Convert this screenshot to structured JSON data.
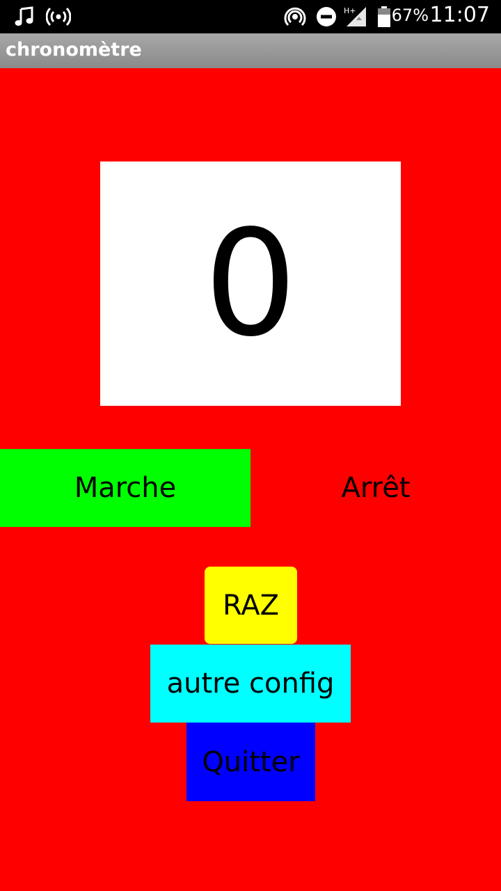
{
  "status_bar": {
    "icons": [
      "music-note-icon",
      "hotspot-icon",
      "nfc-icon",
      "do-not-disturb-icon",
      "signal-h-plus-icon",
      "battery-icon"
    ],
    "network_type": "H+",
    "battery_percent": "67%",
    "time": "11:07"
  },
  "app": {
    "title": "chronomètre"
  },
  "counter": {
    "value": "0"
  },
  "buttons": {
    "start": "Marche",
    "stop": "Arrêt",
    "reset": "RAZ",
    "other_config": "autre config",
    "quit": "Quitter"
  },
  "colors": {
    "background": "#ff0000",
    "start_button": "#00ff00",
    "reset_button": "#ffff00",
    "config_button": "#00ffff",
    "quit_button": "#0000ff",
    "counter_box": "#ffffff"
  }
}
